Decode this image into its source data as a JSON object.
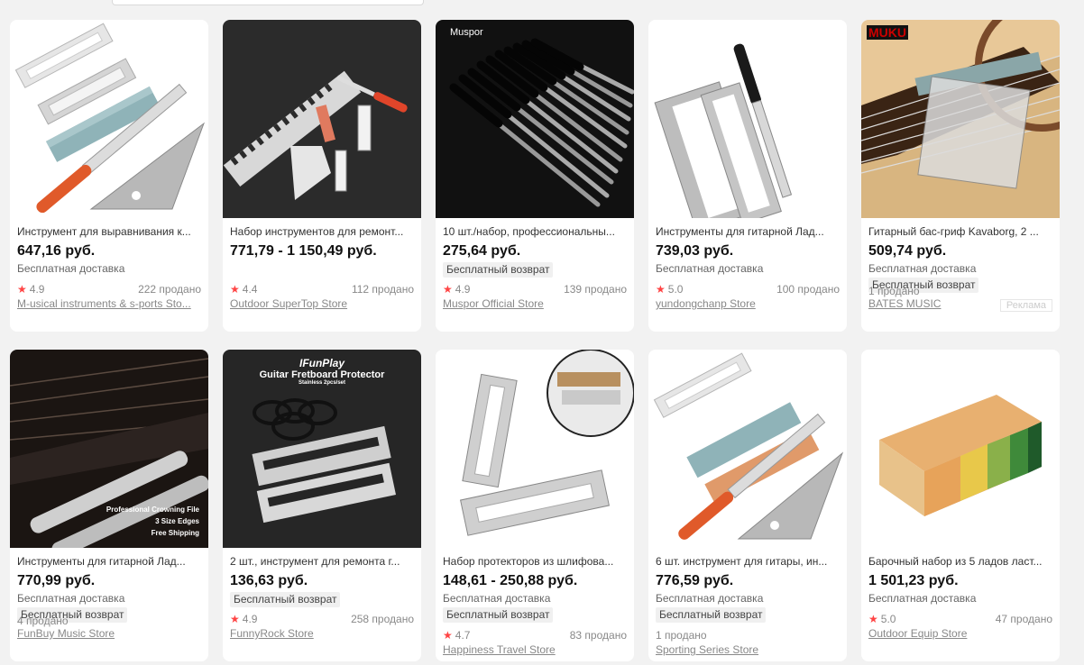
{
  "search_hint": "",
  "products": [
    {
      "title": "Инструмент для выравнивания к...",
      "price": "647,16 руб.",
      "shipping": "Бесплатная доставка",
      "badge": "",
      "rating": "4.9",
      "sold": "222 продано",
      "store": "M-usical instruments & s-ports Sto..."
    },
    {
      "title": "Набор инструментов для ремонт...",
      "price": "771,79 - 1 150,49 руб.",
      "shipping": "",
      "badge": "",
      "rating": "4.4",
      "sold": "112 продано",
      "store": "Outdoor SuperTop Store"
    },
    {
      "title": "10 шт./набор, профессиональны...",
      "price": "275,64 руб.",
      "shipping": "",
      "badge": "Бесплатный возврат",
      "rating": "4.9",
      "sold": "139 продано",
      "store": "Muspor Official Store",
      "image_brand": "Muspor"
    },
    {
      "title": "Инструменты для гитарной Лад...",
      "price": "739,03 руб.",
      "shipping": "Бесплатная доставка",
      "badge": "",
      "rating": "5.0",
      "sold": "100 продано",
      "store": "yundongchanp Store"
    },
    {
      "title": "Гитарный бас-гриф Kavaborg, 2 ...",
      "price": "509,74 руб.",
      "shipping": "Бесплатная доставка",
      "badge": "Бесплатный возврат",
      "rating": "",
      "sold": "1 продано",
      "store": "BATES MUSIC",
      "ad": "Реклама",
      "image_brand": "MUKU"
    },
    {
      "title": "Инструменты для гитарной Лад...",
      "price": "770,99 руб.",
      "shipping": "Бесплатная доставка",
      "badge": "Бесплатный возврат",
      "rating": "",
      "sold": "4 продано",
      "store": "FunBuy Music Store",
      "image_text": [
        "Professional Crowning File",
        "3 Size Edges",
        "Free Shipping"
      ]
    },
    {
      "title": "2 шт., инструмент для ремонта г...",
      "price": "136,63 руб.",
      "shipping": "",
      "badge": "Бесплатный возврат",
      "rating": "4.9",
      "sold": "258 продано",
      "store": "FunnyRock Store",
      "image_text": [
        "IFunPlay",
        "Guitar Fretboard Protector",
        "Stainless 2pcs/set"
      ]
    },
    {
      "title": "Набор протекторов из шлифова...",
      "price": "148,61 - 250,88 руб.",
      "shipping": "Бесплатная доставка",
      "badge": "Бесплатный возврат",
      "rating": "4.7",
      "sold": "83 продано",
      "store": "Happiness Travel Store"
    },
    {
      "title": "6 шт. инструмент для гитары, ин...",
      "price": "776,59 руб.",
      "shipping": "Бесплатная доставка",
      "badge": "Бесплатный возврат",
      "rating": "",
      "sold": "1 продано",
      "store": "Sporting Series Store"
    },
    {
      "title": "Барочный набор из 5 ладов ласт...",
      "price": "1 501,23 руб.",
      "shipping": "Бесплатная доставка",
      "badge": "",
      "rating": "5.0",
      "sold": "47 продано",
      "store": "Outdoor Equip Store"
    }
  ],
  "colors": {
    "star": "#ff4747",
    "bg": "#f2f2f2",
    "card": "#ffffff"
  }
}
